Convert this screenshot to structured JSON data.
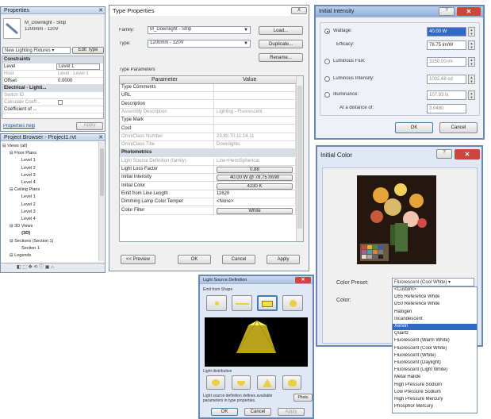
{
  "properties": {
    "title": "Properties",
    "type_name": "M_Downlight - Strip",
    "type_sub": "1200mm - 120V",
    "selector": "New Lighting Fixtures ▾",
    "edit_type": "Edit Type",
    "groups": [
      "Constraints",
      "Electrical - Lighti..."
    ],
    "rows": [
      {
        "k": "Level",
        "v": "Level 1"
      },
      {
        "k": "Host",
        "v": "Level : Level 1"
      },
      {
        "k": "Offset",
        "v": "0.0000"
      },
      {
        "k": "Switch ID",
        "v": ""
      },
      {
        "k": "Calculate Coeff...",
        "v": ""
      },
      {
        "k": "Coefficient of ...",
        "v": ""
      }
    ],
    "help": "Properties help",
    "apply": "Apply"
  },
  "project_browser": {
    "title": "Project Browser - Project1.rvt",
    "items": [
      {
        "t": "Views (all)",
        "d": 0,
        "b": true
      },
      {
        "t": "Floor Plans",
        "d": 1,
        "b": true
      },
      {
        "t": "Level 1",
        "d": 2
      },
      {
        "t": "Level 2",
        "d": 2
      },
      {
        "t": "Level 3",
        "d": 2
      },
      {
        "t": "Level 4",
        "d": 2
      },
      {
        "t": "Ceiling Plans",
        "d": 1,
        "b": true
      },
      {
        "t": "Level 1",
        "d": 2
      },
      {
        "t": "Level 2",
        "d": 2
      },
      {
        "t": "Level 3",
        "d": 2
      },
      {
        "t": "Level 4",
        "d": 2
      },
      {
        "t": "3D Views",
        "d": 1,
        "b": true
      },
      {
        "t": "{3D}",
        "d": 2,
        "bold": true
      },
      {
        "t": "Sections (Section 1)",
        "d": 1,
        "b": true
      },
      {
        "t": "Section 1",
        "d": 2
      },
      {
        "t": "Legends",
        "d": 1,
        "b": true
      }
    ]
  },
  "type_props": {
    "title": "Type Properties",
    "family_label": "Family:",
    "family_value": "M_Downlight - Strip",
    "type_label": "Type:",
    "type_value": "1200mm - 120V",
    "load": "Load...",
    "duplicate": "Duplicate...",
    "rename": "Rename...",
    "type_params": "Type Parameters",
    "col_param": "Parameter",
    "col_value": "Value",
    "rows": [
      {
        "k": "Type Comments",
        "v": "",
        "s": ""
      },
      {
        "k": "URL",
        "v": "",
        "s": ""
      },
      {
        "k": "Description",
        "v": "",
        "s": ""
      },
      {
        "k": "Assembly Description",
        "v": "Lighting - Fluorescent",
        "s": "gray"
      },
      {
        "k": "Type Mark",
        "v": "",
        "s": ""
      },
      {
        "k": "Cost",
        "v": "",
        "s": ""
      },
      {
        "k": "OmniClass Number",
        "v": "23.80.70.11.14.11",
        "s": "gray"
      },
      {
        "k": "OmniClass Title",
        "v": "Downlights",
        "s": "gray"
      },
      {
        "k": "Photometrics",
        "v": "",
        "s": "sec"
      },
      {
        "k": "Light Source Definition (family)",
        "v": "Line+HemiSpherical",
        "s": "gray"
      },
      {
        "k": "Light Loss Factor",
        "v": "0.88",
        "s": "btn"
      },
      {
        "k": "Initial Intensity",
        "v": "40.00 W @ 78.75 lm/W",
        "s": "btn"
      },
      {
        "k": "Initial Color",
        "v": "4230 K",
        "s": "btn"
      },
      {
        "k": "Emit from Line Length",
        "v": "11620",
        "s": ""
      },
      {
        "k": "Dimming Lamp Color Temper",
        "v": "<None>",
        "s": ""
      },
      {
        "k": "Color Filter",
        "v": "White",
        "s": "btn"
      }
    ],
    "preview": "<< Preview",
    "ok": "OK",
    "cancel": "Cancel",
    "apply": "Apply",
    "close": "X"
  },
  "intensity": {
    "title": "Initial Intensity",
    "wattage_label": "Wattage:",
    "wattage_value": "40.00 W",
    "efficacy_label": "Efficacy:",
    "efficacy_value": "78.75 lm/W",
    "flux_label": "Luminous Flux:",
    "flux_value": "3150.00 lm",
    "lint_label": "Luminous Intensity:",
    "lint_value": "1002.68 cd",
    "illum_label": "Illuminance:",
    "illum_value": "107.93 lx",
    "distance_label": "At a distance of:",
    "distance_value": "3.0480",
    "ok": "OK",
    "cancel": "Cancel"
  },
  "color": {
    "title": "Initial Color",
    "preset_label": "Color Preset:",
    "preset_value": "Fluorescent (Cool White) ▾",
    "color_label": "Color:",
    "options": [
      "<Custom>",
      "D65 Reference White",
      "D50 Reference White",
      "Halogen",
      "Incandescent",
      "Xenon",
      "Quartz",
      "Fluorescent (Warm White)",
      "Fluorescent (Cool White)",
      "Fluorescent (White)",
      "Fluorescent (Daylight)",
      "Fluorescent (Light White)",
      "Metal Halide",
      "High Pressure Sodium",
      "Low Pressure Sodium",
      "High Pressure Mercury",
      "Phosphor Mercury"
    ],
    "selected_index": 5
  },
  "light_source": {
    "title": "Light Source Definition",
    "emit_shape": "Emit from Shape",
    "distribution": "Light distribution",
    "note": "Light source definition defines available parameters in type properties.",
    "photo": "Photo",
    "ok": "OK",
    "cancel": "Cancel",
    "apply": "Apply"
  },
  "colors": {
    "accent": "#316ac5",
    "titlebar": "#c3d3ea",
    "close": "#c9473d"
  }
}
